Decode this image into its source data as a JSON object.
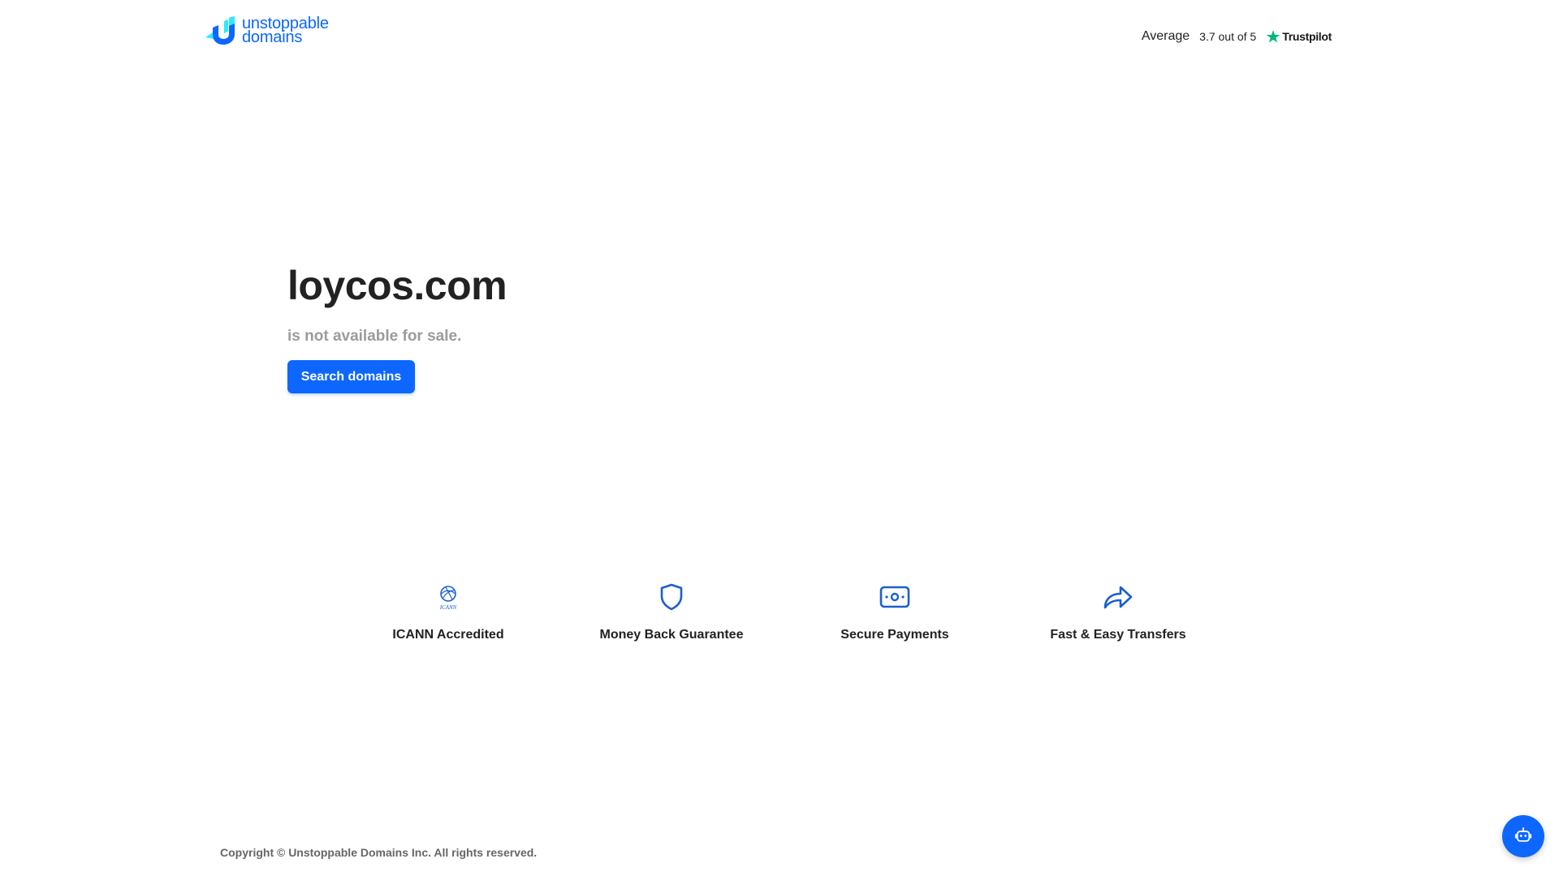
{
  "header": {
    "logo": {
      "line1": "unstoppable",
      "line2": "domains"
    },
    "rating": {
      "average_label": "Average",
      "score_text": "3.7 out of 5",
      "provider": "Trustpilot"
    }
  },
  "hero": {
    "domain": "loycos.com",
    "status": "is not available for sale.",
    "button_label": "Search domains"
  },
  "features": [
    {
      "label": "ICANN Accredited",
      "icon": "icann-icon"
    },
    {
      "label": "Money Back Guarantee",
      "icon": "shield-icon"
    },
    {
      "label": "Secure Payments",
      "icon": "cash-icon"
    },
    {
      "label": "Fast & Easy Transfers",
      "icon": "forward-arrow-icon"
    }
  ],
  "icann_badge_text": "ICANN",
  "footer": {
    "copyright": "Copyright © Unstoppable Domains Inc. All rights reserved."
  },
  "colors": {
    "brand_blue": "#0d67fe",
    "trustpilot_green": "#00b67a",
    "muted_text": "#9b9b9b"
  }
}
